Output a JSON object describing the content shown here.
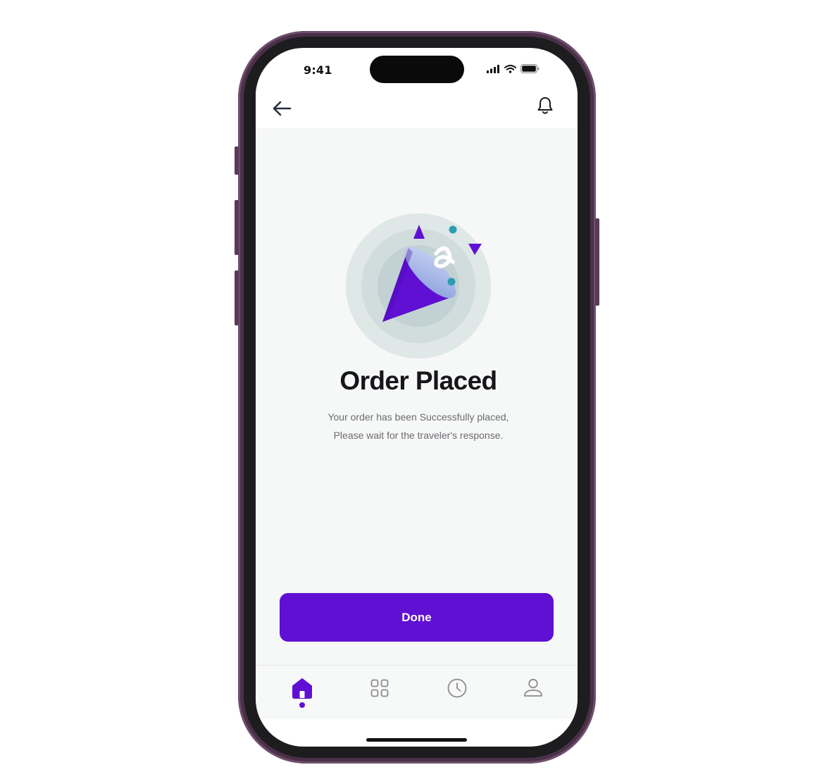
{
  "status_bar": {
    "time": "9:41"
  },
  "header": {
    "back_icon": "arrow-left-icon",
    "notification_icon": "bell-icon"
  },
  "confirmation": {
    "illustration": "party-popper-icon",
    "title": "Order Placed",
    "message_line1": "Your order has been Successfully placed,",
    "message_line2": "Please wait for the traveler's response."
  },
  "actions": {
    "done_label": "Done"
  },
  "tab_bar": {
    "items": [
      {
        "icon": "home-icon",
        "active": true
      },
      {
        "icon": "grid-icon",
        "active": false
      },
      {
        "icon": "clock-icon",
        "active": false
      },
      {
        "icon": "user-icon",
        "active": false
      }
    ]
  },
  "colors": {
    "primary": "#5f10d2",
    "accent_teal": "#2b9db1",
    "background": "#f6f7f7",
    "frame": "#4a3048"
  }
}
